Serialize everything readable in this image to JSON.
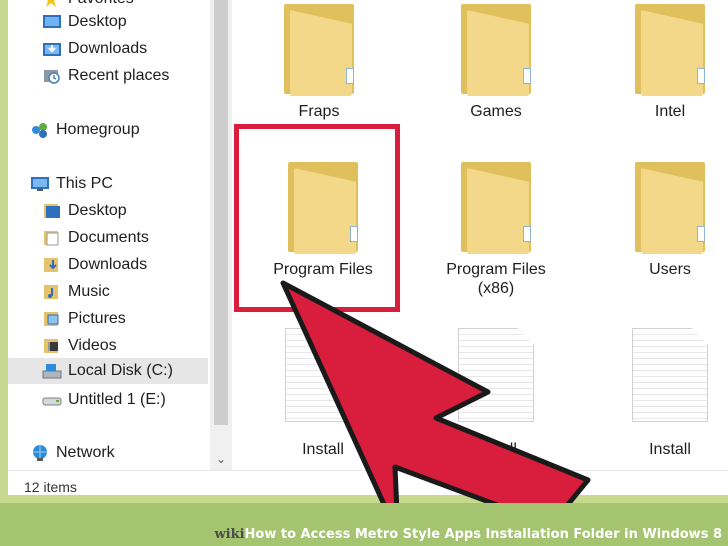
{
  "nav": {
    "items": [
      {
        "label": "Favorites",
        "icon": "star-icon"
      },
      {
        "label": "Desktop",
        "icon": "desktop-icon"
      },
      {
        "label": "Downloads",
        "icon": "downloads-icon"
      },
      {
        "label": "Recent places",
        "icon": "recent-places-icon"
      },
      {
        "label": "Homegroup",
        "icon": "homegroup-icon"
      },
      {
        "label": "This PC",
        "icon": "computer-icon"
      },
      {
        "label": "Desktop",
        "icon": "desktop-icon"
      },
      {
        "label": "Documents",
        "icon": "documents-icon"
      },
      {
        "label": "Downloads",
        "icon": "downloads-icon"
      },
      {
        "label": "Music",
        "icon": "music-icon"
      },
      {
        "label": "Pictures",
        "icon": "pictures-icon"
      },
      {
        "label": "Videos",
        "icon": "videos-icon"
      },
      {
        "label": "Local Disk (C:)",
        "icon": "local-disk-icon"
      },
      {
        "label": "Untitled 1 (E:)",
        "icon": "removable-drive-icon"
      },
      {
        "label": "Network",
        "icon": "network-icon"
      }
    ],
    "selected_label": "Local Disk (C:)"
  },
  "scroll": {
    "down_glyph": "⌄"
  },
  "status": {
    "item_count": "12 items"
  },
  "files": {
    "items": [
      {
        "label": "Fraps",
        "type": "folder"
      },
      {
        "label": "Games",
        "type": "folder"
      },
      {
        "label": "Intel",
        "type": "folder"
      },
      {
        "label": "Program Files",
        "type": "folder"
      },
      {
        "label": "Program Files (x86)",
        "type": "folder"
      },
      {
        "label": "Users",
        "type": "folder"
      },
      {
        "label": "Install",
        "type": "file"
      },
      {
        "label": "Install",
        "type": "file"
      },
      {
        "label": "Install",
        "type": "file"
      }
    ]
  },
  "footer": {
    "brand": "wiki",
    "how": "How",
    "title": " to Access Metro Style Apps Installation Folder in Windows 8"
  },
  "colors": {
    "accent_red": "#d81e3c",
    "frame_green": "#a5c470",
    "folder_yellow": "#f3d889"
  }
}
